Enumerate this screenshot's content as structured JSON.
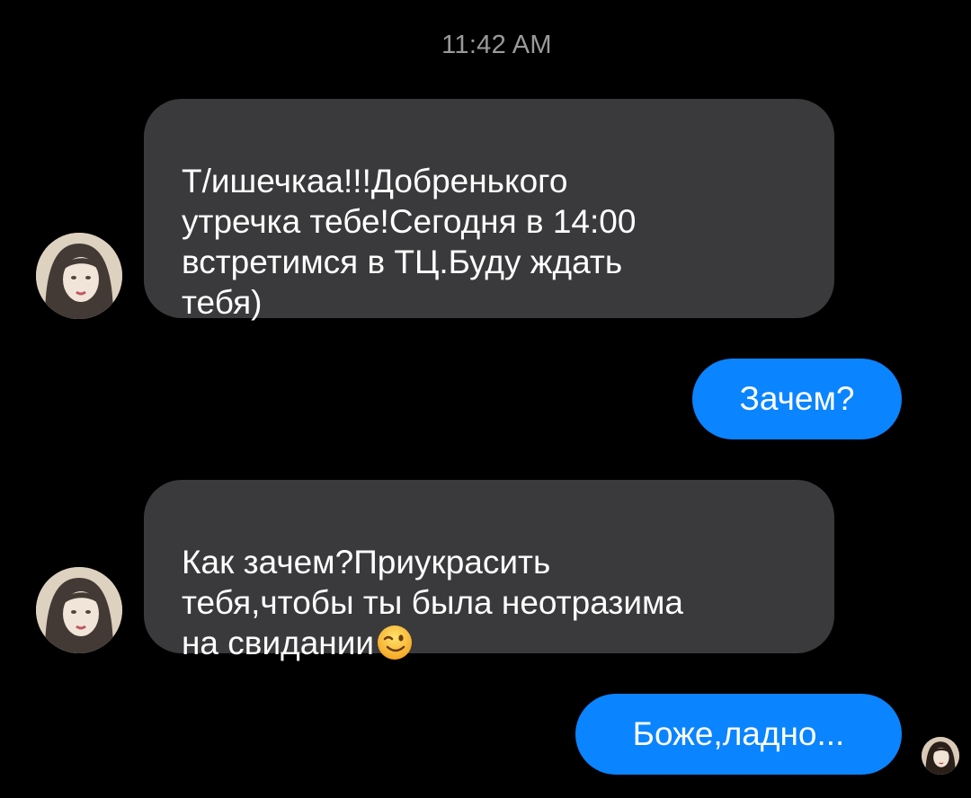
{
  "conversation": {
    "timestamp": "11:42 AM",
    "messages": [
      {
        "direction": "incoming",
        "text": "Т/ишечкаа!!!Добренького\nутречка тебе!Сегодня в 14:00\nвстретимся в ТЦ.Буду ждать\nтебя)"
      },
      {
        "direction": "outgoing",
        "text": "Зачем?"
      },
      {
        "direction": "incoming",
        "text": "Как зачем?Приукрасить\nтебя,чтобы ты была неотразима\nна свидании",
        "emoji": "winking-face-emoji"
      },
      {
        "direction": "outgoing",
        "text": "Боже,ладно..."
      }
    ]
  },
  "colors": {
    "background": "#000000",
    "incoming_bubble": "#3a3a3c",
    "outgoing_bubble": "#0a84ff",
    "timestamp_text": "#9a9a9a",
    "message_text": "#ffffff"
  },
  "icons": {
    "contact_avatar": "contact-avatar-photo",
    "read_receipt": "read-receipt-avatar",
    "emoji": "winking-face-emoji"
  }
}
